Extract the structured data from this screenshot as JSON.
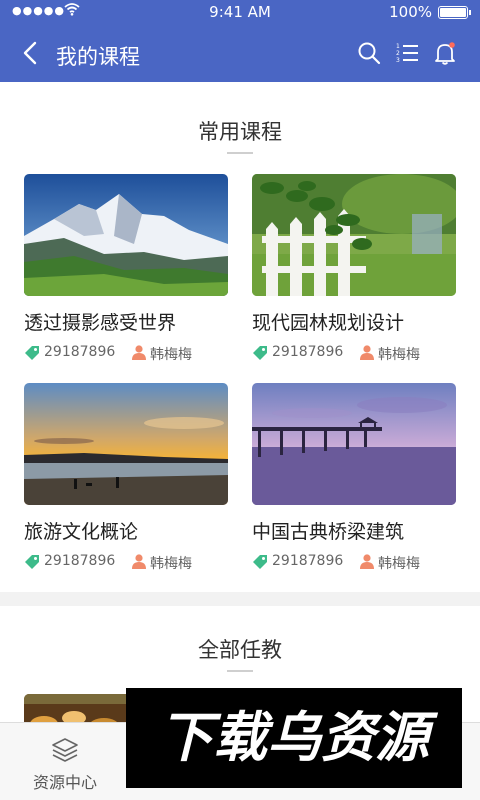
{
  "status_bar": {
    "signal": "●●●●●",
    "time": "9:41 AM",
    "battery": "100%"
  },
  "nav": {
    "title": "我的课程",
    "icons": [
      "back-icon",
      "search-icon",
      "list-icon",
      "bell-icon"
    ]
  },
  "frequent": {
    "title": "常用课程",
    "courses": [
      {
        "name": "透过摄影感受世界",
        "count": "29187896",
        "teacher": "韩梅梅",
        "image": "mountain"
      },
      {
        "name": "现代园林规划设计",
        "count": "29187896",
        "teacher": "韩梅梅",
        "image": "garden-fence"
      },
      {
        "name": "旅游文化概论",
        "count": "29187896",
        "teacher": "韩梅梅",
        "image": "beach-sunset"
      },
      {
        "name": "中国古典桥梁建筑",
        "count": "29187896",
        "teacher": "韩梅梅",
        "image": "pier"
      }
    ]
  },
  "all": {
    "title": "全部任教"
  },
  "tabs": [
    {
      "label": "资源中心",
      "icon": "layers-icon"
    }
  ],
  "watermark": {
    "text": "下载乌资源"
  },
  "colors": {
    "primary": "#4a66c4",
    "tag": "#3dbb8a",
    "user": "#f08a6a"
  }
}
